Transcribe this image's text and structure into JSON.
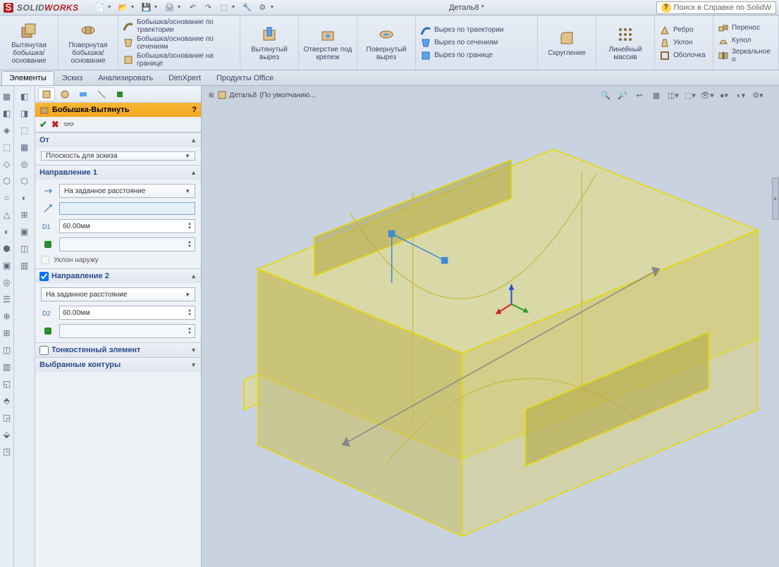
{
  "app": {
    "name_prefix": "SOLID",
    "name_suffix": "WORKS",
    "doc_title": "Деталь8 *",
    "search_placeholder": "Поиск в Справке по SolidW"
  },
  "ribbon": {
    "extrude_boss": "Вытянутая бобышка/основание",
    "revolve_boss": "Повернутая бобышка/основание",
    "sweep_boss": "Бобышка/основание по траектории",
    "loft_boss": "Бобышка/основание по сечениям",
    "boundary_boss": "Бобышка/основание на границе",
    "extrude_cut": "Вытянутый вырез",
    "hole": "Отверстие под крепеж",
    "revolve_cut": "Повернутый вырез",
    "sweep_cut": "Вырез по траектории",
    "loft_cut": "Вырез по сечениям",
    "boundary_cut": "Вырез по границе",
    "fillet": "Скругление",
    "pattern": "Линейный массив",
    "rib": "Ребро",
    "draft": "Уклон",
    "shell": "Оболочка",
    "move": "Перенос",
    "dome": "Купол",
    "mirror": "Зеркальное о"
  },
  "tabs": {
    "features": "Элементы",
    "sketch": "Эскиз",
    "evaluate": "Анализировать",
    "dimxpert": "DimXpert",
    "office": "Продукты Office"
  },
  "pm": {
    "title": "Бобышка-Вытянуть",
    "from_head": "От",
    "from_value": "Плоскость для эскиза",
    "dir1_head": "Направление 1",
    "dir2_head": "Направление 2",
    "end_cond": "На заданное расстояние",
    "depth1": "60.00мм",
    "depth2": "60.00мм",
    "draft_out": "Уклон наружу",
    "thin_head": "Тонкостенный элемент",
    "contours_head": "Выбранные контуры"
  },
  "breadcrumb": {
    "doc": "Деталь8",
    "config": "(По умолчанию..."
  }
}
